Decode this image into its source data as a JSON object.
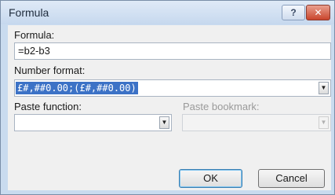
{
  "window": {
    "title": "Formula",
    "help_glyph": "?",
    "close_glyph": "✕"
  },
  "formula": {
    "label": "Formula:",
    "value": "=b2-b3"
  },
  "number_format": {
    "label": "Number format:",
    "value": "£#,##0.00;(£#,##0.00)"
  },
  "paste_function": {
    "label": "Paste function:",
    "value": ""
  },
  "paste_bookmark": {
    "label": "Paste bookmark:",
    "value": "",
    "enabled": false
  },
  "buttons": {
    "ok": "OK",
    "cancel": "Cancel"
  },
  "colors": {
    "title_bar": "#c6d8ee",
    "selection": "#3c72c6",
    "close": "#c9452c"
  }
}
